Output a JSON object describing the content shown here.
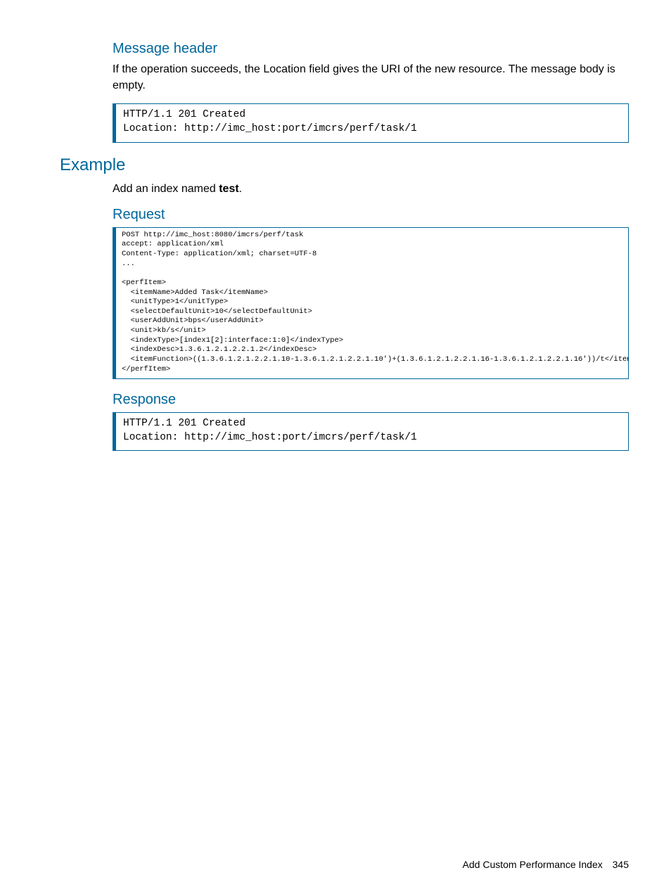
{
  "section1": {
    "heading": "Message header",
    "paragraph": "If the operation succeeds, the Location field gives the URI of the new resource. The message body is empty.",
    "code": "HTTP/1.1 201 Created\nLocation: http://imc_host:port/imcrs/perf/task/1"
  },
  "example": {
    "heading": "Example",
    "intro_prefix": "Add an index named ",
    "intro_bold": "test",
    "intro_suffix": ".",
    "request": {
      "heading": "Request",
      "code": "POST http://imc_host:8080/imcrs/perf/task\naccept: application/xml\nContent-Type: application/xml; charset=UTF-8\n...\n\n<perfItem>\n  <itemName>Added Task</itemName>\n  <unitType>1</unitType>\n  <selectDefaultUnit>10</selectDefaultUnit>\n  <userAddUnit>bps</userAddUnit>\n  <unit>kb/s</unit>\n  <indexType>[index1[2]:interface:1:0]</indexType>\n  <indexDesc>1.3.6.1.2.1.2.2.1.2</indexDesc>\n  <itemFunction>((1.3.6.1.2.1.2.2.1.10-1.3.6.1.2.1.2.2.1.10')+(1.3.6.1.2.1.2.2.1.16-1.3.6.1.2.1.2.2.1.16'))/t</itemFunction>\n</perfItem>"
    },
    "response": {
      "heading": "Response",
      "code": "HTTP/1.1 201 Created\nLocation: http://imc_host:port/imcrs/perf/task/1"
    }
  },
  "footer": {
    "title": "Add Custom Performance Index",
    "page": "345"
  }
}
